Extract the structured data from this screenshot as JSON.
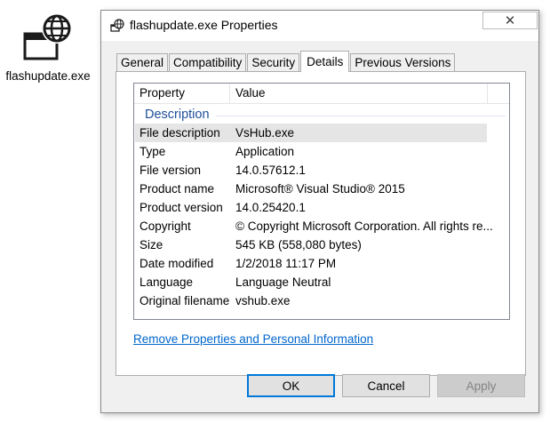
{
  "desktop": {
    "icon": "web-application-icon",
    "file_label": "flashupdate.exe"
  },
  "window": {
    "title": "flashupdate.exe Properties",
    "title_icon": "properties-icon",
    "close_icon": "close-icon",
    "close_glyph": "✕"
  },
  "tabs": [
    {
      "label": "General",
      "active": false
    },
    {
      "label": "Compatibility",
      "active": false
    },
    {
      "label": "Security",
      "active": false
    },
    {
      "label": "Details",
      "active": true
    },
    {
      "label": "Previous Versions",
      "active": false
    }
  ],
  "details": {
    "columns": {
      "property": "Property",
      "value": "Value"
    },
    "group": "Description",
    "rows": [
      {
        "property": "File description",
        "value": "VsHub.exe"
      },
      {
        "property": "Type",
        "value": "Application"
      },
      {
        "property": "File version",
        "value": "14.0.57612.1"
      },
      {
        "property": "Product name",
        "value": "Microsoft® Visual Studio® 2015"
      },
      {
        "property": "Product version",
        "value": "14.0.25420.1"
      },
      {
        "property": "Copyright",
        "value": "© Copyright Microsoft Corporation. All rights re..."
      },
      {
        "property": "Size",
        "value": "545 KB (558,080 bytes)"
      },
      {
        "property": "Date modified",
        "value": "1/2/2018 11:17 PM"
      },
      {
        "property": "Language",
        "value": "Language Neutral"
      },
      {
        "property": "Original filename",
        "value": "vshub.exe"
      }
    ],
    "selected_row": "File description"
  },
  "remove_link": "Remove Properties and Personal Information",
  "buttons": {
    "ok": "OK",
    "cancel": "Cancel",
    "apply": "Apply"
  },
  "colors": {
    "accent": "#0078d7",
    "link": "#0066cc",
    "group_header": "#1e4e9a"
  }
}
